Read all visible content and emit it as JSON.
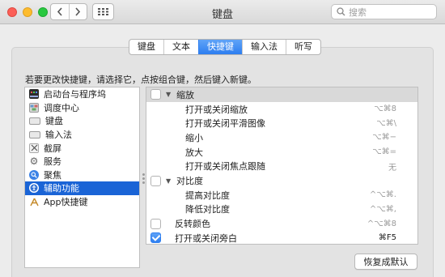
{
  "window": {
    "title": "键盘",
    "search_placeholder": "搜索"
  },
  "tabs": [
    {
      "label": "键盘",
      "active": false
    },
    {
      "label": "文本",
      "active": false
    },
    {
      "label": "快捷键",
      "active": true
    },
    {
      "label": "输入法",
      "active": false
    },
    {
      "label": "听写",
      "active": false
    }
  ],
  "instruction": "若要更改快捷键，请选择它，点按组合键，然后键入新键。",
  "categories": [
    {
      "label": "启动台与程序坞",
      "icon": "launchpad-dock-icon",
      "selected": false
    },
    {
      "label": "调度中心",
      "icon": "mission-control-icon",
      "selected": false
    },
    {
      "label": "键盘",
      "icon": "keyboard-icon",
      "selected": false
    },
    {
      "label": "输入法",
      "icon": "input-method-icon",
      "selected": false
    },
    {
      "label": "截屏",
      "icon": "screenshot-icon",
      "selected": false
    },
    {
      "label": "服务",
      "icon": "gear-icon",
      "selected": false
    },
    {
      "label": "聚焦",
      "icon": "spotlight-icon",
      "selected": false
    },
    {
      "label": "辅助功能",
      "icon": "accessibility-icon",
      "selected": true
    },
    {
      "label": "App快捷键",
      "icon": "app-shortcuts-icon",
      "selected": false
    }
  ],
  "shortcuts": [
    {
      "label": "缩放",
      "key": "",
      "group": true,
      "checkbox": true,
      "checked": false,
      "indent": 1
    },
    {
      "label": "打开或关闭缩放",
      "key": "⌥⌘8",
      "group": false,
      "checkbox": false,
      "checked": false,
      "indent": 2
    },
    {
      "label": "打开或关闭平滑图像",
      "key": "⌥⌘\\",
      "group": false,
      "checkbox": false,
      "checked": false,
      "indent": 2
    },
    {
      "label": "缩小",
      "key": "⌥⌘−",
      "group": false,
      "checkbox": false,
      "checked": false,
      "indent": 2
    },
    {
      "label": "放大",
      "key": "⌥⌘=",
      "group": false,
      "checkbox": false,
      "checked": false,
      "indent": 2
    },
    {
      "label": "打开或关闭焦点跟随",
      "key": "无",
      "group": false,
      "checkbox": false,
      "checked": false,
      "indent": 2
    },
    {
      "label": "对比度",
      "key": "",
      "group": true,
      "checkbox": true,
      "checked": false,
      "indent": 1
    },
    {
      "label": "提高对比度",
      "key": "^⌥⌘.",
      "group": false,
      "checkbox": false,
      "checked": false,
      "indent": 2
    },
    {
      "label": "降低对比度",
      "key": "^⌥⌘,",
      "group": false,
      "checkbox": false,
      "checked": false,
      "indent": 2
    },
    {
      "label": "反转颜色",
      "key": "^⌥⌘8",
      "group": false,
      "checkbox": true,
      "checked": false,
      "indent": 0
    },
    {
      "label": "打开或关闭旁白",
      "key": "⌘F5",
      "group": false,
      "checkbox": true,
      "checked": true,
      "indent": 0
    }
  ],
  "reset_button": "恢复成默认",
  "colors": {
    "accent": "#2d7ef0",
    "selection": "#1a64d6",
    "close": "#fc5f57",
    "minimize": "#fdbc2e",
    "maximize": "#29c840"
  }
}
